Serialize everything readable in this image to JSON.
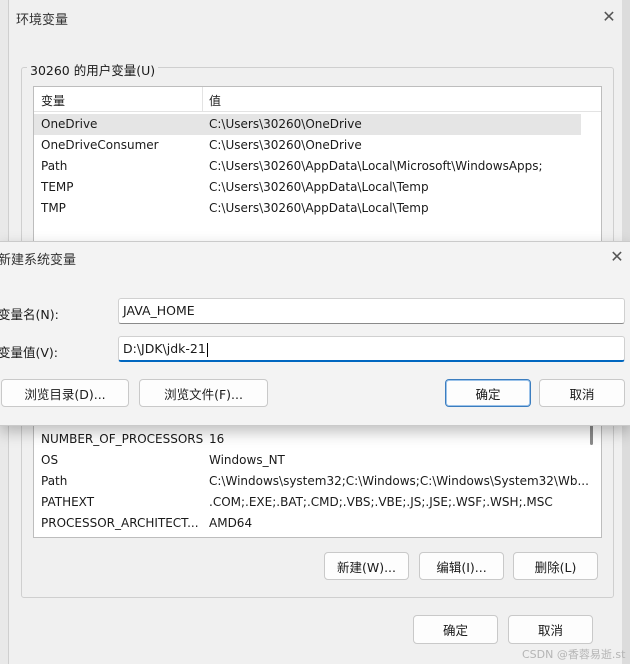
{
  "env_window": {
    "title": "环境变量",
    "user_group_label": "30260 的用户变量(U)",
    "columns": [
      "变量",
      "值"
    ],
    "user_vars": [
      {
        "name": "OneDrive",
        "value": "C:\\Users\\30260\\OneDrive"
      },
      {
        "name": "OneDriveConsumer",
        "value": "C:\\Users\\30260\\OneDrive"
      },
      {
        "name": "Path",
        "value": "C:\\Users\\30260\\AppData\\Local\\Microsoft\\WindowsApps;"
      },
      {
        "name": "TEMP",
        "value": "C:\\Users\\30260\\AppData\\Local\\Temp"
      },
      {
        "name": "TMP",
        "value": "C:\\Users\\30260\\AppData\\Local\\Temp"
      }
    ],
    "system_vars": [
      {
        "name": "NUMBER_OF_PROCESSORS",
        "value": "16"
      },
      {
        "name": "OS",
        "value": "Windows_NT"
      },
      {
        "name": "Path",
        "value": "C:\\Windows\\system32;C:\\Windows;C:\\Windows\\System32\\Wb..."
      },
      {
        "name": "PATHEXT",
        "value": ".COM;.EXE;.BAT;.CMD;.VBS;.VBE;.JS;.JSE;.WSF;.WSH;.MSC"
      },
      {
        "name": "PROCESSOR_ARCHITECT...",
        "value": "AMD64"
      }
    ],
    "buttons": {
      "new": "新建(W)...",
      "edit": "编辑(I)...",
      "delete": "删除(L)",
      "ok": "确定",
      "cancel": "取消"
    }
  },
  "new_var_dialog": {
    "title": "新建系统变量",
    "name_label": "变量名(N):",
    "value_label": "变量值(V):",
    "name_value": "JAVA_HOME",
    "value_value": "D:\\JDK\\jdk-21",
    "buttons": {
      "browse_dir": "浏览目录(D)...",
      "browse_file": "浏览文件(F)...",
      "ok": "确定",
      "cancel": "取消"
    }
  },
  "watermark": "CSDN @香蓉易逝.st"
}
